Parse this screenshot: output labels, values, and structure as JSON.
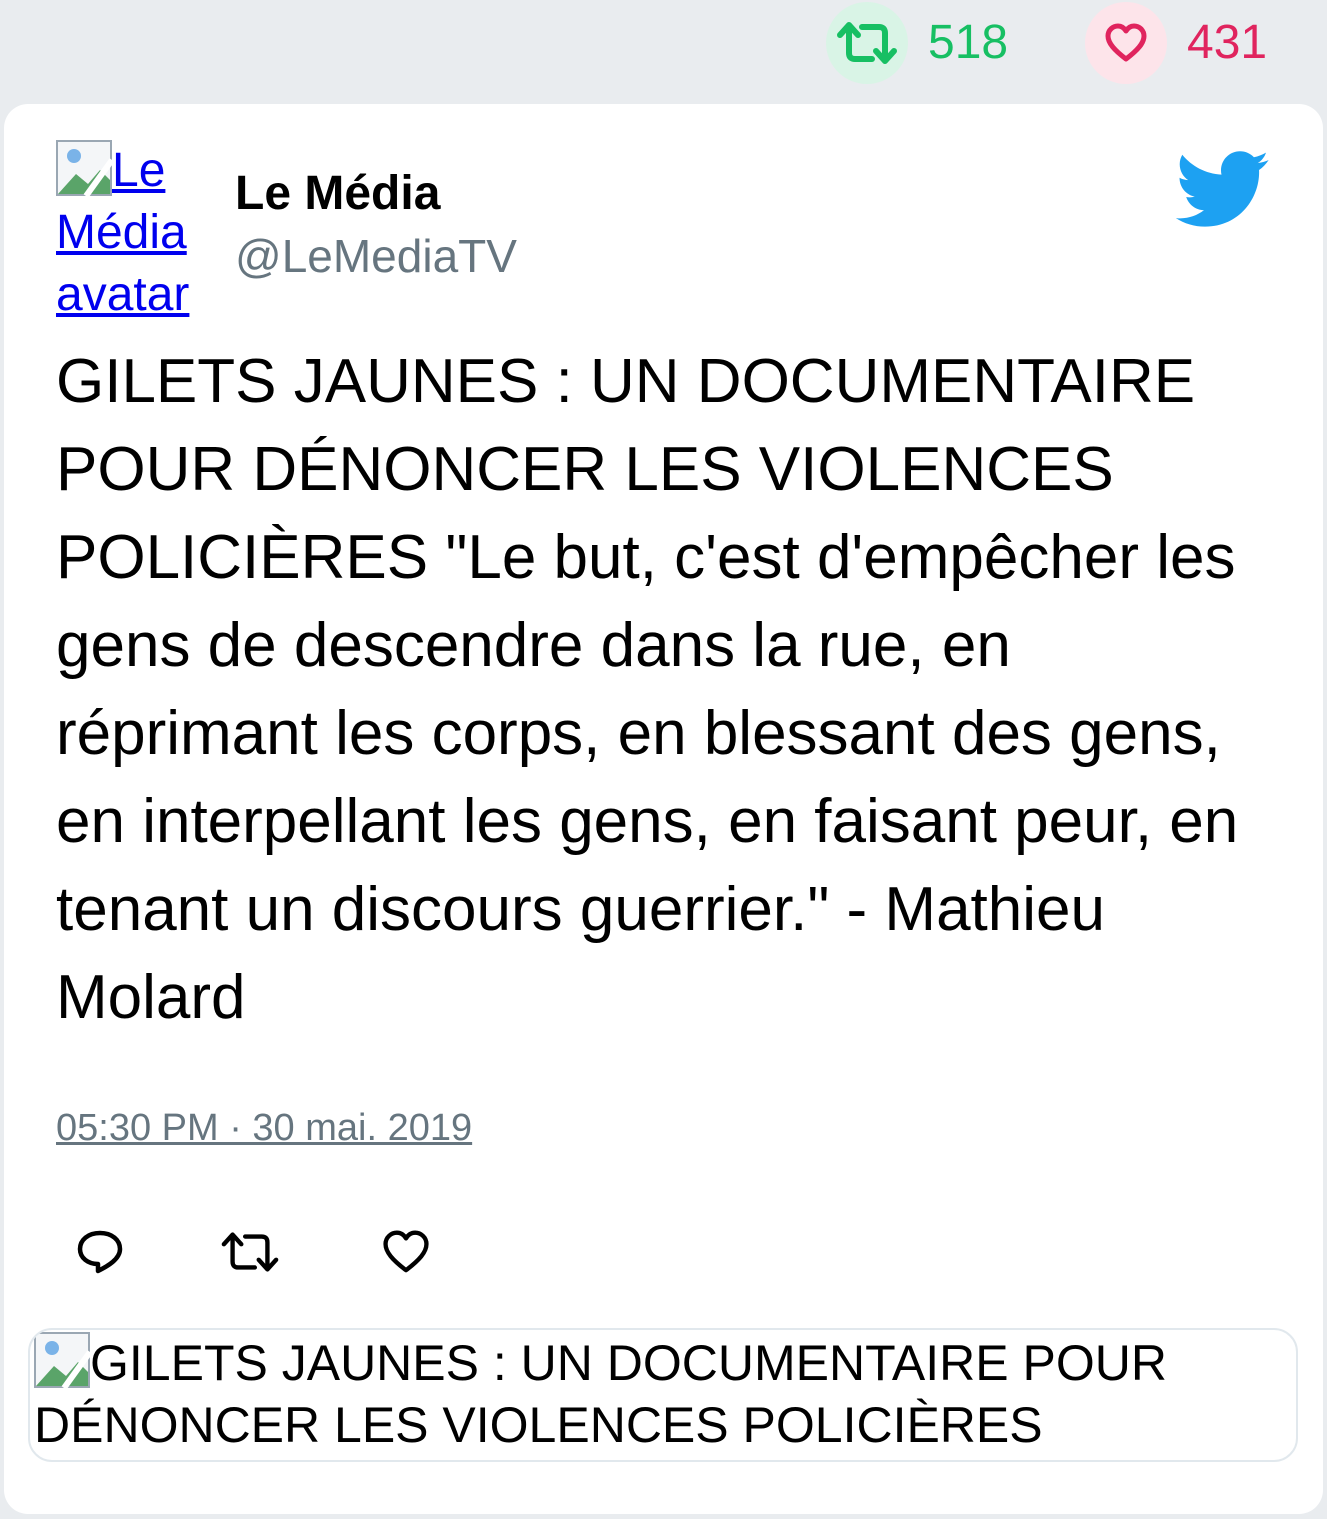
{
  "stats": {
    "retweets": "518",
    "likes": "431",
    "retweet_icon": "retweet-icon",
    "like_icon": "heart-icon"
  },
  "tweet": {
    "avatar_alt": "Le Média avatar",
    "author_name": "Le Média",
    "author_handle": "@LeMediaTV",
    "text": "GILETS JAUNES : UN DOCUMENTAIRE POUR DÉNONCER LES VIOLENCES POLICIÈRES \"Le but, c'est d'empêcher les gens de descendre dans la rue, en réprimant les corps, en blessant des gens, en interpellant les gens, en faisant peur, en tenant un discours guerrier.\" - Mathieu Molard",
    "timestamp": "05:30 PM · 30 mai. 2019",
    "media_alt": "GILETS JAUNES : UN DOCUMENTAIRE POUR DÉNONCER LES VIOLENCES POLICIÈRES"
  },
  "actions": {
    "reply_icon": "reply-icon",
    "retweet_icon": "retweet-icon",
    "like_icon": "heart-icon"
  },
  "colors": {
    "retweet": "#17bf63",
    "like": "#e0245e",
    "twitter_blue": "#1da1f2",
    "muted": "#66757f"
  }
}
